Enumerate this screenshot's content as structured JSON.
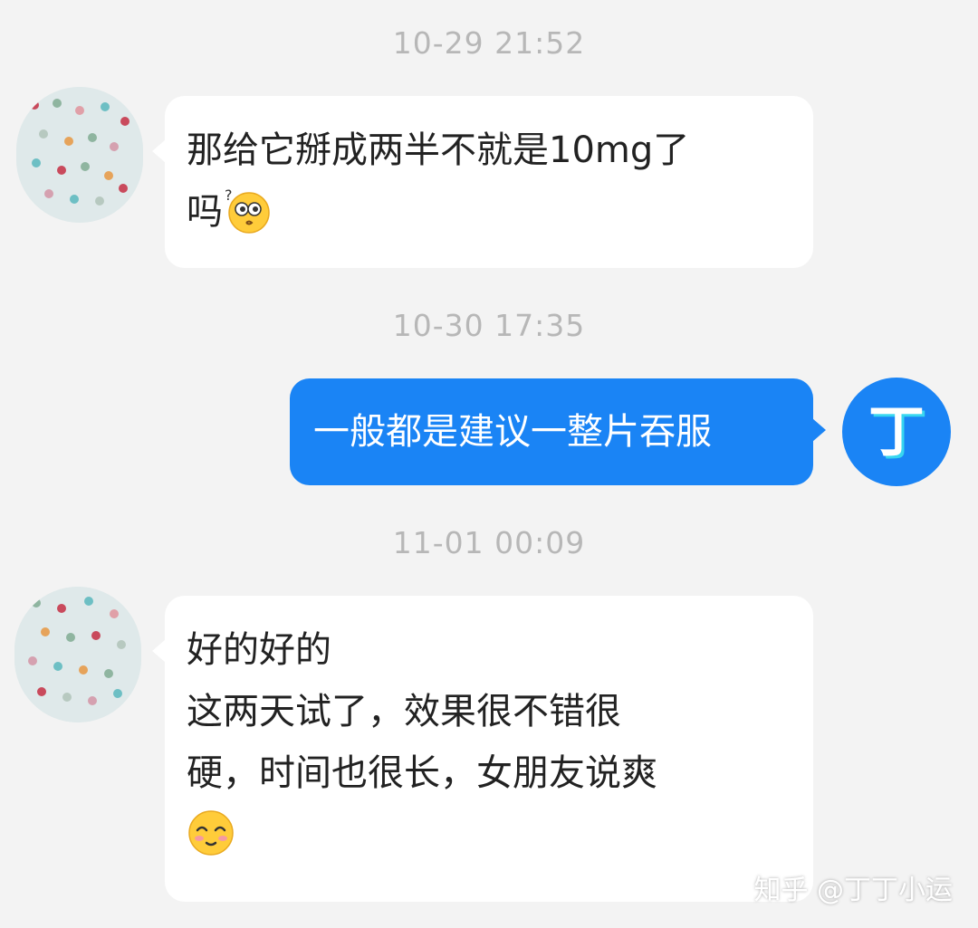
{
  "messages": [
    {
      "timestamp": "10-29 21:52",
      "sender": "contact",
      "lines": [
        "那给它掰成两半不就是10mg了",
        "吗"
      ],
      "emoji": "thinking-face-emoji"
    },
    {
      "timestamp": "10-30 17:35",
      "sender": "me",
      "lines": [
        "一般都是建议一整片吞服"
      ]
    },
    {
      "timestamp": "11-01 00:09",
      "sender": "contact",
      "lines": [
        "好的好的",
        "这两天试了，效果很不错很",
        "硬，时间也很长，女朋友说爽"
      ],
      "emoji": "pleased-face-emoji"
    }
  ],
  "me_avatar_text": "丁",
  "watermark": "知乎 @丁丁小运",
  "colors": {
    "background": "#f3f3f3",
    "outgoing_bubble": "#1a84f5",
    "incoming_bubble": "#ffffff",
    "timestamp": "#b7b7b7"
  }
}
